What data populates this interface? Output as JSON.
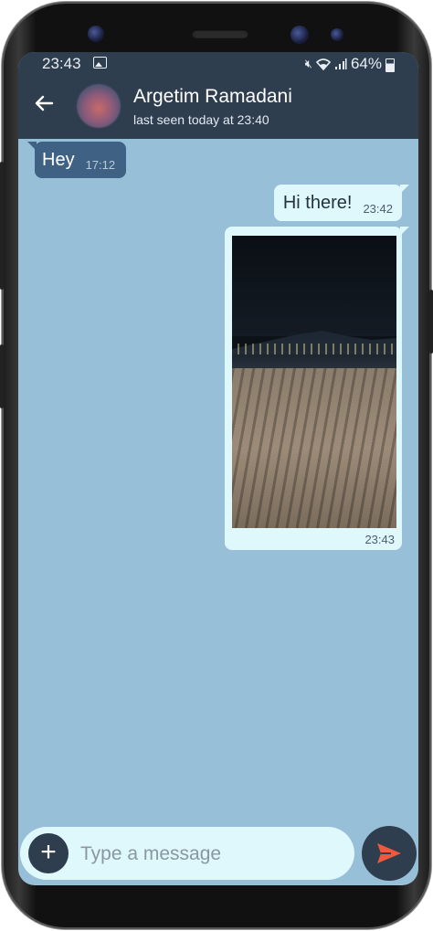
{
  "status_bar": {
    "time": "23:43",
    "battery": "64%",
    "icons": [
      "image-icon",
      "mute-icon",
      "wifi-icon",
      "signal-icon",
      "battery-icon"
    ]
  },
  "header": {
    "back_icon": "arrow-left-icon",
    "contact_name": "Argetim Ramadani",
    "last_seen": "last seen today at 23:40"
  },
  "messages": [
    {
      "direction": "incoming",
      "text": "Hey",
      "time": "17:12"
    },
    {
      "direction": "outgoing",
      "text": "Hi there!",
      "time": "23:42"
    },
    {
      "direction": "outgoing",
      "type": "image",
      "time": "23:43"
    }
  ],
  "composer": {
    "attach_icon": "plus-icon",
    "placeholder": "Type a message",
    "value": "",
    "send_icon": "send-icon"
  },
  "colors": {
    "header": "#2f3e4f",
    "chat_background": "#98bfd8",
    "incoming_bubble": "#3f6284",
    "outgoing_bubble": "#dff8fb",
    "send_accent": "#ef5a3c"
  }
}
